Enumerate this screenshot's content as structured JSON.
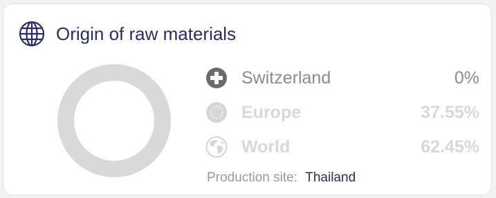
{
  "card": {
    "title": "Origin of raw materials",
    "title_icon": "globe-icon"
  },
  "origins": [
    {
      "label": "Switzerland",
      "value": "0%",
      "icon": "swiss-cross-icon",
      "state": "active"
    },
    {
      "label": "Europe",
      "value": "37.55%",
      "icon": "eu-stars-icon",
      "state": "muted"
    },
    {
      "label": "World",
      "value": "62.45%",
      "icon": "earth-icon",
      "state": "muted"
    }
  ],
  "donut": {
    "ring_color": "#d9d9d9",
    "shares_percent": [
      0,
      37.55,
      62.45
    ]
  },
  "production_site": {
    "label": "Production site:",
    "value": "Thailand"
  },
  "colors": {
    "accent": "#2a2d62",
    "active_icon": "#6b6b6b",
    "muted": "#d8d8d8"
  }
}
